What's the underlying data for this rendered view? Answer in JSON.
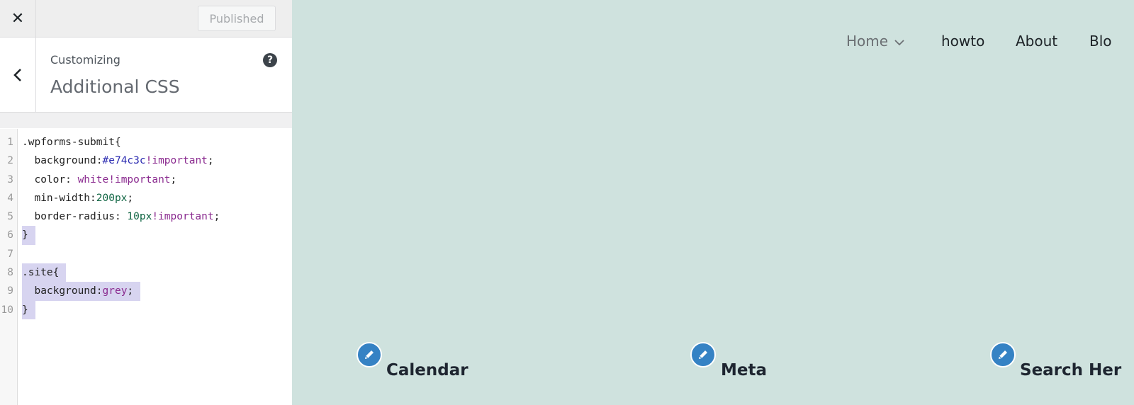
{
  "sidebar": {
    "close_icon": "close-icon",
    "publish_label": "Published",
    "customizing_label": "Customizing",
    "section_title": "Additional CSS",
    "help_glyph": "?"
  },
  "editor": {
    "lines": [
      {
        "n": "1",
        "sel": false,
        "tokens": [
          {
            "t": ".wpforms-submit{",
            "c": ""
          }
        ]
      },
      {
        "n": "2",
        "sel": false,
        "tokens": [
          {
            "t": "  background:",
            "c": ""
          },
          {
            "t": "#e74c3c",
            "c": "hex"
          },
          {
            "t": "!important",
            "c": "kw"
          },
          {
            "t": ";",
            "c": ""
          }
        ]
      },
      {
        "n": "3",
        "sel": false,
        "tokens": [
          {
            "t": "  color: ",
            "c": ""
          },
          {
            "t": "white",
            "c": "atom"
          },
          {
            "t": "!important",
            "c": "kw"
          },
          {
            "t": ";",
            "c": ""
          }
        ]
      },
      {
        "n": "4",
        "sel": false,
        "tokens": [
          {
            "t": "  min-width:",
            "c": ""
          },
          {
            "t": "200px",
            "c": "num"
          },
          {
            "t": ";",
            "c": ""
          }
        ]
      },
      {
        "n": "5",
        "sel": false,
        "tokens": [
          {
            "t": "  border-radius: ",
            "c": ""
          },
          {
            "t": "10px",
            "c": "num"
          },
          {
            "t": "!important",
            "c": "kw"
          },
          {
            "t": ";",
            "c": ""
          }
        ]
      },
      {
        "n": "6",
        "sel": true,
        "tokens": [
          {
            "t": "}",
            "c": ""
          }
        ]
      },
      {
        "n": "7",
        "sel": false,
        "tokens": []
      },
      {
        "n": "8",
        "sel": true,
        "tokens": [
          {
            "t": ".site{",
            "c": ""
          }
        ]
      },
      {
        "n": "9",
        "sel": true,
        "tokens": [
          {
            "t": "  background:",
            "c": ""
          },
          {
            "t": "grey",
            "c": "atom"
          },
          {
            "t": ";",
            "c": ""
          }
        ]
      },
      {
        "n": "10",
        "sel": true,
        "tokens": [
          {
            "t": "}",
            "c": ""
          }
        ]
      }
    ]
  },
  "preview": {
    "background": "#cfe2de",
    "nav": [
      {
        "label": "Home",
        "has_dropdown": true,
        "color": "#6b6f73"
      },
      {
        "label": "howto",
        "has_dropdown": false
      },
      {
        "label": "About",
        "has_dropdown": false
      },
      {
        "label": "Blo",
        "has_dropdown": false
      }
    ],
    "widgets": [
      {
        "title": "Calendar",
        "icon": "pencil-icon"
      },
      {
        "title": "Meta",
        "icon": "pencil-icon"
      },
      {
        "title": "Search Her",
        "icon": "pencil-icon"
      }
    ],
    "edit_badge_color": "#3582c4"
  }
}
